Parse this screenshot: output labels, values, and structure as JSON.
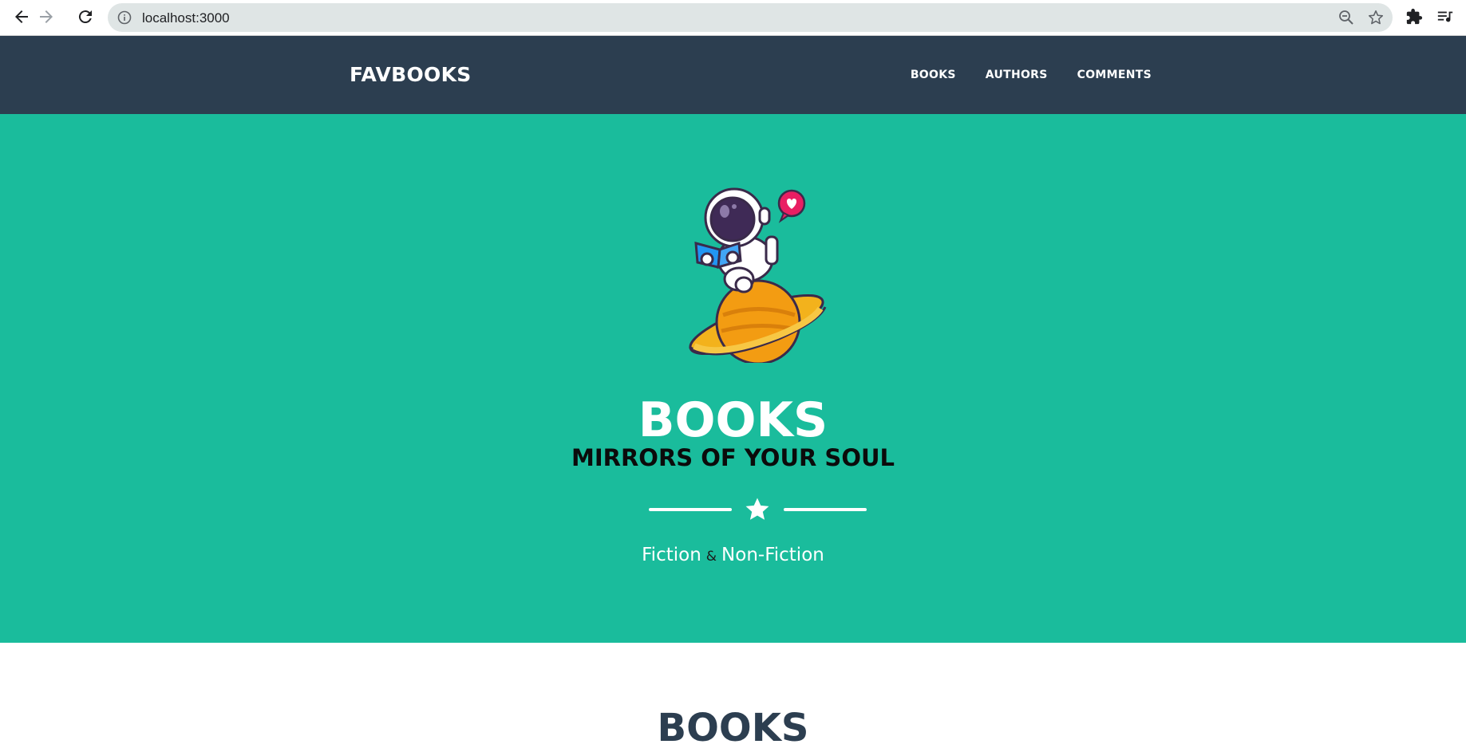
{
  "browser": {
    "url": "localhost:3000",
    "icons": [
      "back-arrow-icon",
      "forward-arrow-icon",
      "reload-icon",
      "info-icon",
      "zoom-out-icon",
      "bookmark-star-icon",
      "extensions-puzzle-icon",
      "reading-list-icon"
    ]
  },
  "header": {
    "brand": "FAVBOOKS",
    "nav": [
      {
        "label": "BOOKS"
      },
      {
        "label": "AUTHORS"
      },
      {
        "label": "COMMENTS"
      }
    ]
  },
  "hero": {
    "title": "BOOKS",
    "subtitle": "MIRRORS OF YOUR SOUL",
    "tagline_left": "Fiction",
    "tagline_amp": "&",
    "tagline_right": "Non-Fiction"
  },
  "section": {
    "title": "BOOKS"
  },
  "colors": {
    "header_bg": "#2c3e50",
    "hero_bg": "#1abc9c",
    "text_light": "#ffffff"
  }
}
